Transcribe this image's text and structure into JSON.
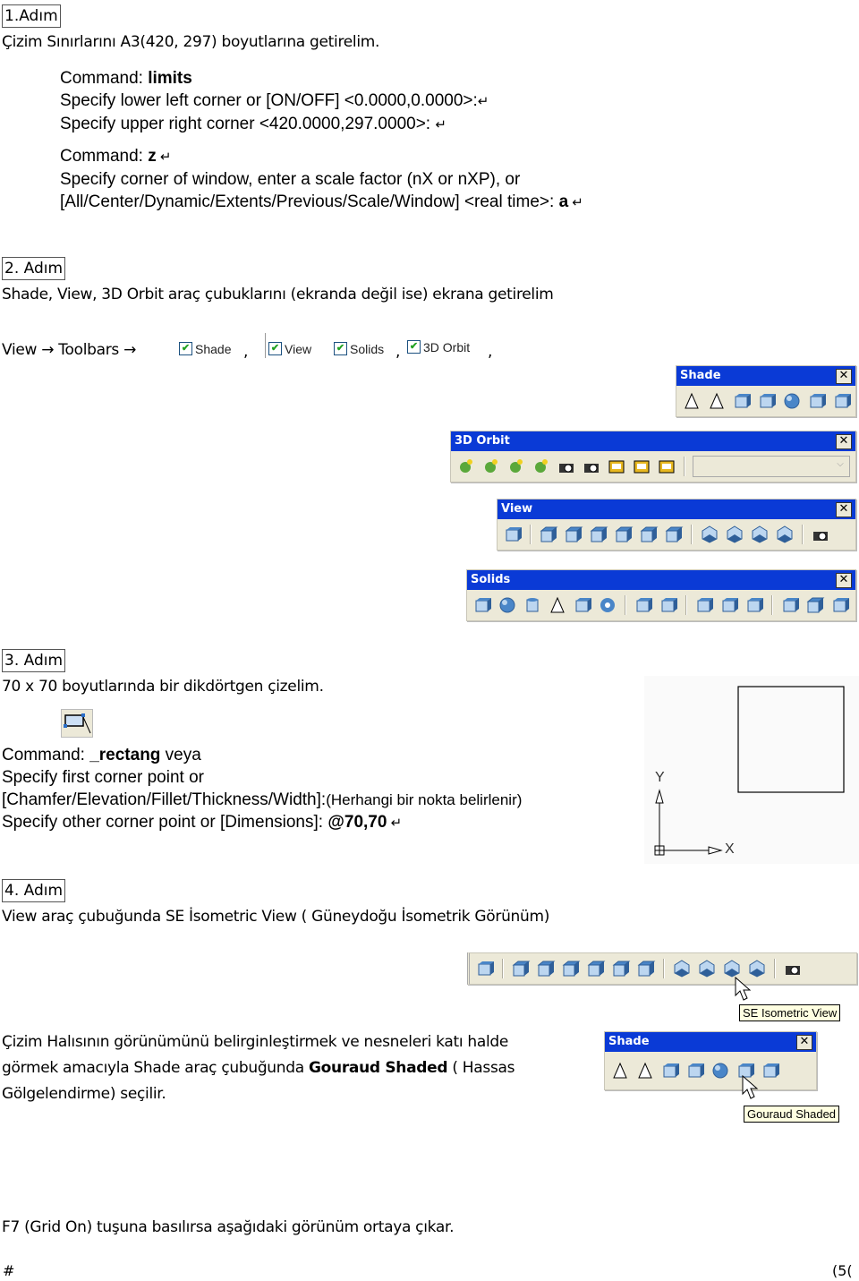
{
  "step1": {
    "label": "1.Adım",
    "description": "Çizim Sınırlarını A3(420, 297) boyutlarına getirelim.",
    "commands": [
      {
        "prefix": "Command: ",
        "bold": "limits",
        "suffix": ""
      },
      {
        "prefix": "Specify lower left corner or [ON/OFF] <0.0000,0.0000>:",
        "bold": "",
        "suffix": "↵"
      },
      {
        "prefix": "Specify upper right corner <420.0000,297.0000>: ",
        "bold": "",
        "suffix": "↵"
      },
      {
        "prefix": "Command: ",
        "bold": "z",
        "suffix": " ↵"
      },
      {
        "prefix": "Specify corner of window, enter a scale factor (nX or nXP), or",
        "bold": "",
        "suffix": ""
      },
      {
        "prefix": "[All/Center/Dynamic/Extents/Previous/Scale/Window] <real time>: ",
        "bold": "a",
        "suffix": " ↵"
      }
    ]
  },
  "step2": {
    "label": "2. Adım",
    "description": "Shade, View, 3D Orbit araç çubuklarını (ekranda değil ise) ekrana getirelim",
    "menu_path": "View → Toolbars →",
    "checkboxes": [
      {
        "label": "Shade",
        "checked": true
      },
      {
        "label": "View",
        "checked": true
      },
      {
        "label": "Solids",
        "checked": true
      },
      {
        "label": "3D Orbit",
        "checked": true
      }
    ],
    "comma": ","
  },
  "toolbars": {
    "shade": {
      "title": "Shade",
      "close": "✕",
      "icons": [
        "2d-wireframe-icon",
        "3d-wireframe-icon",
        "hidden-icon",
        "flat-shaded-icon",
        "gouraud-shaded-icon",
        "flat-shaded-edges-icon",
        "gouraud-shaded-edges-icon"
      ]
    },
    "orbit": {
      "title": "3D Orbit",
      "close": "✕",
      "icons": [
        "3d-pan-icon",
        "3d-zoom-icon",
        "3d-orbit-icon",
        "3d-continuous-orbit-icon",
        "3d-swivel-icon",
        "3d-adjust-distance-icon",
        "3d-adjust-clip-planes-icon",
        "front-clip-icon",
        "back-clip-icon"
      ],
      "dropdown_value": ""
    },
    "view": {
      "title": "View",
      "close": "✕",
      "icons": [
        "named-views-icon",
        "top-view-icon",
        "bottom-view-icon",
        "left-view-icon",
        "right-view-icon",
        "front-view-icon",
        "back-view-icon",
        "sw-isometric-icon",
        "se-isometric-icon",
        "ne-isometric-icon",
        "nw-isometric-icon",
        "camera-icon"
      ]
    },
    "solids": {
      "title": "Solids",
      "close": "✕",
      "icons": [
        "box-icon",
        "sphere-icon",
        "cylinder-icon",
        "cone-icon",
        "wedge-icon",
        "torus-icon",
        "extrude-icon",
        "revolve-icon",
        "slice-icon",
        "section-icon",
        "interference-icon",
        "setup-drawing-icon",
        "setup-view-icon",
        "setup-profile-icon"
      ]
    }
  },
  "step3": {
    "label": "3. Adım",
    "description": "70 x 70 boyutlarında bir dikdörtgen çizelim.",
    "commands": [
      {
        "prefix": "Command: ",
        "bold": "_rectang",
        "suffix": " veya"
      },
      {
        "prefix": "Specify first corner point or",
        "bold": "",
        "suffix": ""
      },
      {
        "prefix": "[Chamfer/Elevation/Fillet/Thickness/Width]:",
        "bold": "",
        "suffix": "(Herhangi bir nokta belirlenir)"
      },
      {
        "prefix": "Specify other corner point or [Dimensions]: ",
        "bold": "@70,70",
        "suffix": " ↵"
      }
    ],
    "axis_x": "X",
    "axis_y": "Y"
  },
  "step4": {
    "label": "4. Adım",
    "description": "View araç çubuğunda SE İsometric View ( Güneydoğu İsometrik Görünüm)",
    "tooltip_view": "SE Isometric View",
    "paragraph": [
      "Çizim Halısının görünümünü belirginleştirmek ve nesneleri katı halde",
      "görmek amacıyla Shade araç çubuğunda ",
      "Gouraud Shaded",
      " ( Hassas",
      "Gölgelendirme) seçilir."
    ],
    "tooltip_shade": "Gouraud Shaded"
  },
  "footer": {
    "note": "F7 (Grid On) tuşuna basılırsa aşağıdaki görünüm ortaya çıkar.",
    "left": "#",
    "right": "(5("
  }
}
